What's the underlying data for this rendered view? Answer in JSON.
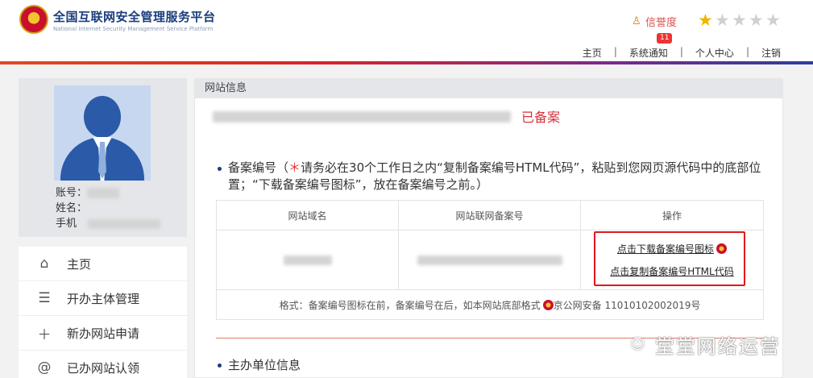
{
  "header": {
    "title": "全国互联网安全管理服务平台",
    "subtitle": "National Internet Security Management Service Platform",
    "credit_label": "信誉度",
    "rating": 1,
    "rating_max": 5,
    "notice_badge": "11",
    "nav": [
      "主页",
      "系统通知",
      "个人中心",
      "注销"
    ]
  },
  "profile": {
    "account_label": "账号：",
    "name_label": "姓名：",
    "phone_label": "手机"
  },
  "sidebar": {
    "items": [
      {
        "label": "主页",
        "icon": "home-icon"
      },
      {
        "label": "开办主体管理",
        "icon": "list-icon"
      },
      {
        "label": "新办网站申请",
        "icon": "plus-icon"
      },
      {
        "label": "已办网站认领",
        "icon": "at-icon"
      }
    ]
  },
  "main": {
    "panel_title": "网站信息",
    "status": "已备案",
    "record_section_title": "备案编号（",
    "record_instruction": "请务必在30个工作日之内“复制备案编号HTML代码”，粘贴到您网页源代码中的底部位置；“下载备案编号图标”，放在备案编号之前。）",
    "table": {
      "headers": [
        "网站域名",
        "网站联网备案号",
        "操作"
      ],
      "download_link": "点击下载备案编号图标",
      "copy_link": "点击复制备案编号HTML代码",
      "format_prefix": "格式：备案编号图标在前，备案编号在后，如本网站底部格式",
      "format_example": "京公网安备 11010102002019号"
    },
    "sponsor_section_title": "主办单位信息"
  },
  "watermark": "堂堂网络运营",
  "colors": {
    "accent_red": "#d9303a",
    "brand_blue": "#1a3d7c",
    "star_on": "#f0b400",
    "star_off": "#d0d0d0"
  }
}
